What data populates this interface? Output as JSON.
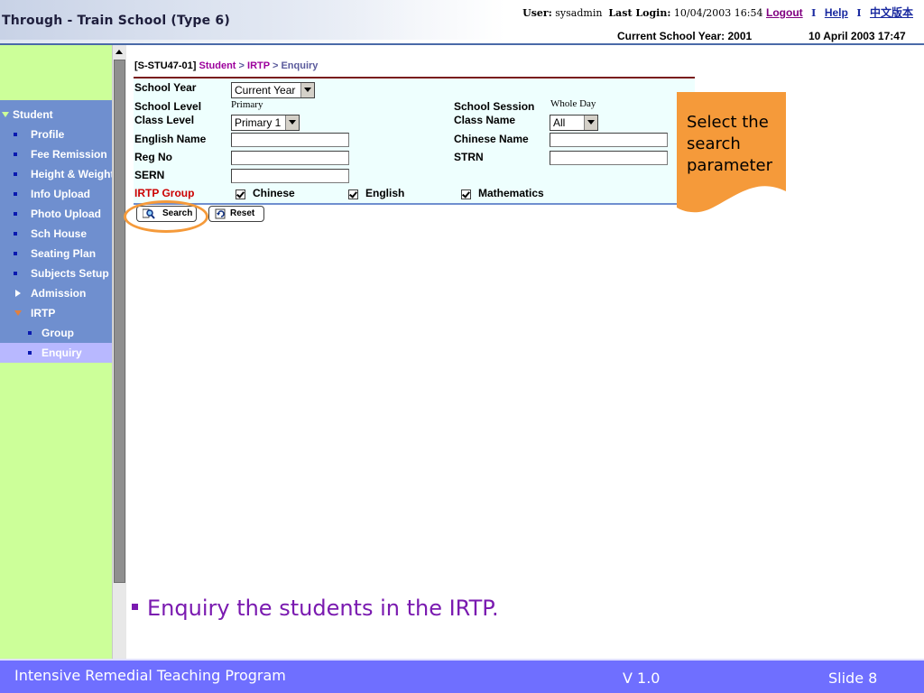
{
  "header": {
    "title": "Through - Train School (Type 6)",
    "user_label": "User:",
    "user_value": "sysadmin",
    "last_login_label": "Last Login:",
    "last_login_value": "10/04/2003 16:54",
    "logout": "Logout",
    "help": "Help",
    "chinese": "中文版本",
    "separator": "I",
    "school_year": "Current School Year: 2001",
    "datetime": "10 April 2003 17:47"
  },
  "sidebar": {
    "items": [
      {
        "label": "Student"
      },
      {
        "label": "Profile"
      },
      {
        "label": "Fee Remission"
      },
      {
        "label": "Height & Weight"
      },
      {
        "label": "Info Upload"
      },
      {
        "label": "Photo Upload"
      },
      {
        "label": "Sch House"
      },
      {
        "label": "Seating Plan"
      },
      {
        "label": "Subjects Setup"
      },
      {
        "label": "Admission"
      },
      {
        "label": "IRTP"
      },
      {
        "label": "Group"
      },
      {
        "label": "Enquiry"
      }
    ]
  },
  "breadcrumb": {
    "code": "[S-STU47-01]",
    "student": "Student",
    "sep1": ">",
    "irtp": "IRTP",
    "sep2": ">",
    "page": "Enquiry"
  },
  "form": {
    "school_year_label": "School Year",
    "school_year_value": "Current Year",
    "school_level_label": "School Level",
    "school_level_value": "Primary",
    "school_session_label": "School Session",
    "school_session_value": "Whole Day",
    "class_level_label": "Class Level",
    "class_level_value": "Primary 1",
    "class_name_label": "Class Name",
    "class_name_value": "All",
    "english_name_label": "English Name",
    "chinese_name_label": "Chinese Name",
    "reg_no_label": "Reg No",
    "strn_label": "STRN",
    "sern_label": "SERN",
    "irtp_group_label": "IRTP Group",
    "groups": [
      {
        "label": "Chinese",
        "checked": true
      },
      {
        "label": "English",
        "checked": true
      },
      {
        "label": "Mathematics",
        "checked": true
      }
    ]
  },
  "buttons": {
    "search": "Search",
    "reset": "Reset"
  },
  "callout": {
    "text": "Select the search parameter",
    "color": "#f59a3a"
  },
  "slide": {
    "bullet": "Enquiry the students in the IRTP.",
    "footer_title": "Intensive Remedial Teaching Program",
    "version": "V 1.0",
    "slide_no": "Slide 8"
  }
}
